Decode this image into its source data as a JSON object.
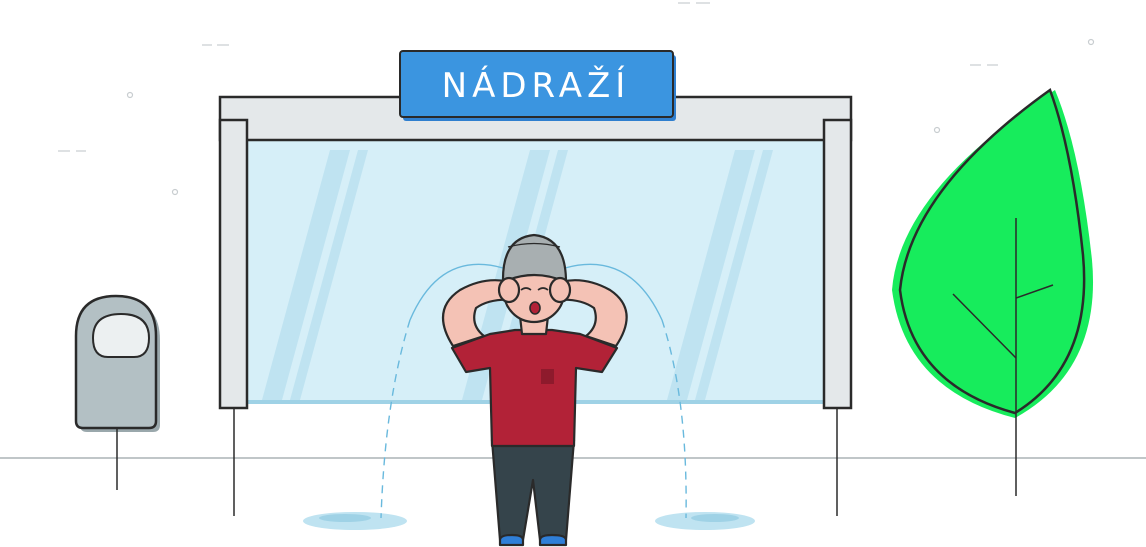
{
  "sign": {
    "label": "NÁDRAŽÍ"
  },
  "colors": {
    "sign_blue": "#3b95e0",
    "glass": "#d6eff8",
    "tree_green": "#17ec5c",
    "shirt_red": "#b22237",
    "pants_dark": "#35444b",
    "cap_grey": "#a8afb1",
    "bin_grey": "#b3c0c4",
    "shoe_blue": "#2f7fd8",
    "tear_blue": "#69b9dd",
    "outline": "#2a2a2a"
  },
  "icons": [
    "trash-bin-icon",
    "tree-icon",
    "crying-person-icon",
    "bus-shelter-icon"
  ]
}
